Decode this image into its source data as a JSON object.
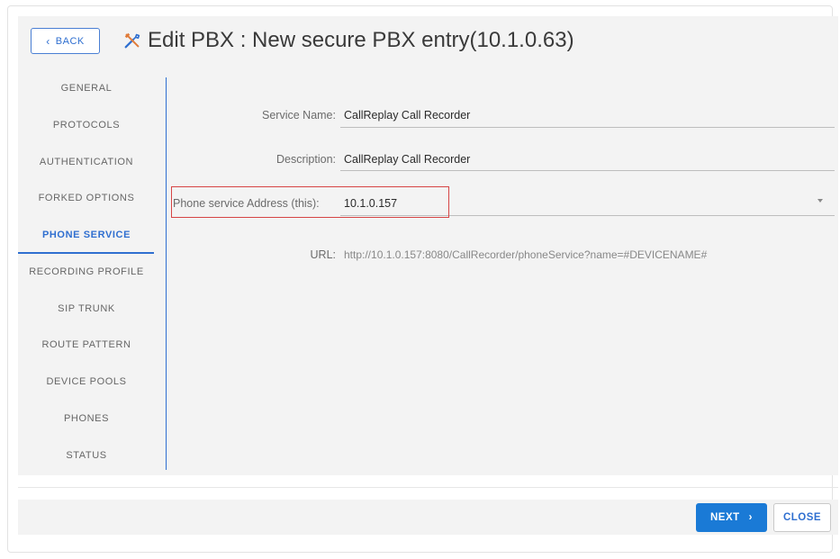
{
  "header": {
    "back_label": "BACK",
    "back_icon": "chevron-left-icon",
    "title_icon": "tools-icon",
    "title": "Edit PBX : New secure PBX entry(10.1.0.63)"
  },
  "sidebar": {
    "active_index": 4,
    "items": [
      {
        "label": "GENERAL"
      },
      {
        "label": "PROTOCOLS"
      },
      {
        "label": "AUTHENTICATION"
      },
      {
        "label": "FORKED OPTIONS"
      },
      {
        "label": "PHONE SERVICE"
      },
      {
        "label": "RECORDING PROFILE"
      },
      {
        "label": "SIP TRUNK"
      },
      {
        "label": "ROUTE PATTERN"
      },
      {
        "label": "DEVICE POOLS"
      },
      {
        "label": "PHONES"
      },
      {
        "label": "STATUS"
      }
    ]
  },
  "form": {
    "service_name": {
      "label": "Service Name:",
      "value": "CallReplay Call Recorder"
    },
    "description": {
      "label": "Description:",
      "value": "CallReplay Call Recorder"
    },
    "phone_service_address": {
      "label": "Phone service Address (this):",
      "value": "10.1.0.157"
    },
    "url": {
      "label": "URL:",
      "value": "http://10.1.0.157:8080/CallRecorder/phoneService?name=#DEVICENAME#"
    }
  },
  "footer": {
    "next_label": "NEXT",
    "next_icon": "chevron-right-icon",
    "close_label": "CLOSE"
  },
  "colors": {
    "accent": "#2f6fd0",
    "primary_button": "#1a7ad6",
    "highlight_border": "#d64545",
    "panel_background": "#f3f3f3"
  }
}
